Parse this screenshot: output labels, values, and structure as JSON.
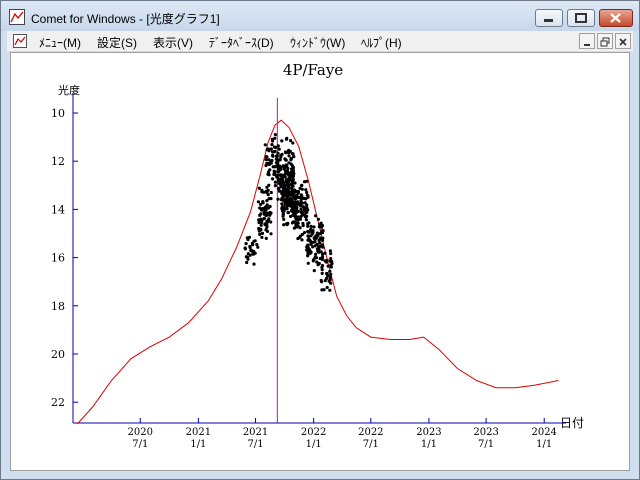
{
  "window": {
    "title": "Comet for Windows - [光度グラフ1]",
    "icon": "chart-app-icon"
  },
  "menu": [
    {
      "label": "ﾒﾆｭｰ(M)"
    },
    {
      "label": "設定(S)"
    },
    {
      "label": "表示(V)"
    },
    {
      "label": "ﾃﾞｰﾀﾍﾞｰｽ(D)"
    },
    {
      "label": "ｳｨﾝﾄﾞｳ(W)"
    },
    {
      "label": "ﾍﾙﾌﾟ(H)"
    }
  ],
  "colors": {
    "curve": "#dd0000",
    "marker": "#cc00cc",
    "axis": "#0000aa",
    "points": "#000000"
  },
  "chart_data": {
    "type": "scatter",
    "title": "4P/Faye",
    "ylabel": "光度",
    "xlabel": "日付",
    "y_reversed": true,
    "ylim": [
      23,
      9
    ],
    "y_ticks": [
      "10",
      "12",
      "14",
      "16",
      "18",
      "20",
      "22"
    ],
    "x_ticks": [
      {
        "year": "2020",
        "date": "7/1"
      },
      {
        "year": "2021",
        "date": "1/1"
      },
      {
        "year": "2021",
        "date": "7/1"
      },
      {
        "year": "2022",
        "date": "1/1"
      },
      {
        "year": "2022",
        "date": "7/1"
      },
      {
        "year": "2023",
        "date": "1/1"
      },
      {
        "year": "2023",
        "date": "7/1"
      },
      {
        "year": "2024",
        "date": "1/1"
      }
    ],
    "perihelion_marker": "2021-09-08",
    "predicted_curve": [
      [
        "2019-12-15",
        22.9
      ],
      [
        "2020-02-01",
        22.2
      ],
      [
        "2020-04-01",
        21.1
      ],
      [
        "2020-06-01",
        20.2
      ],
      [
        "2020-08-01",
        19.7
      ],
      [
        "2020-10-01",
        19.3
      ],
      [
        "2020-12-01",
        18.7
      ],
      [
        "2021-02-01",
        17.8
      ],
      [
        "2021-03-15",
        16.9
      ],
      [
        "2021-05-01",
        15.6
      ],
      [
        "2021-06-15",
        14.1
      ],
      [
        "2021-07-15",
        12.6
      ],
      [
        "2021-08-10",
        11.2
      ],
      [
        "2021-09-01",
        10.5
      ],
      [
        "2021-09-20",
        10.3
      ],
      [
        "2021-10-15",
        10.6
      ],
      [
        "2021-11-15",
        11.4
      ],
      [
        "2021-12-15",
        12.8
      ],
      [
        "2022-01-15",
        14.5
      ],
      [
        "2022-02-15",
        16.2
      ],
      [
        "2022-03-15",
        17.6
      ],
      [
        "2022-04-15",
        18.4
      ],
      [
        "2022-05-15",
        18.9
      ],
      [
        "2022-07-01",
        19.3
      ],
      [
        "2022-09-01",
        19.4
      ],
      [
        "2022-11-01",
        19.4
      ],
      [
        "2022-12-15",
        19.3
      ],
      [
        "2023-02-01",
        19.8
      ],
      [
        "2023-04-01",
        20.6
      ],
      [
        "2023-06-01",
        21.1
      ],
      [
        "2023-08-01",
        21.4
      ],
      [
        "2023-10-01",
        21.4
      ],
      [
        "2023-12-01",
        21.3
      ],
      [
        "2024-02-15",
        21.1
      ]
    ],
    "observations": {
      "description_free": true,
      "clusters": [
        {
          "from": "2021-05-25",
          "to": "2021-07-10",
          "mag_center": 15.6,
          "spread": 0.5,
          "count": 30
        },
        {
          "from": "2021-07-10",
          "to": "2021-08-20",
          "mag_center": 14.2,
          "spread": 0.8,
          "count": 70
        },
        {
          "from": "2021-08-01",
          "to": "2021-09-10",
          "mag_center": 12.0,
          "spread": 0.9,
          "count": 60
        },
        {
          "from": "2021-09-10",
          "to": "2021-11-01",
          "mag_center": 12.6,
          "spread": 1.0,
          "count": 150
        },
        {
          "from": "2021-09-20",
          "to": "2021-11-10",
          "mag_center": 13.8,
          "spread": 0.7,
          "count": 120
        },
        {
          "from": "2021-11-01",
          "to": "2021-12-15",
          "mag_center": 14.0,
          "spread": 0.9,
          "count": 90
        },
        {
          "from": "2021-12-10",
          "to": "2022-02-01",
          "mag_center": 15.3,
          "spread": 0.8,
          "count": 90
        },
        {
          "from": "2022-01-25",
          "to": "2022-03-01",
          "mag_center": 16.4,
          "spread": 0.7,
          "count": 40
        }
      ]
    }
  }
}
